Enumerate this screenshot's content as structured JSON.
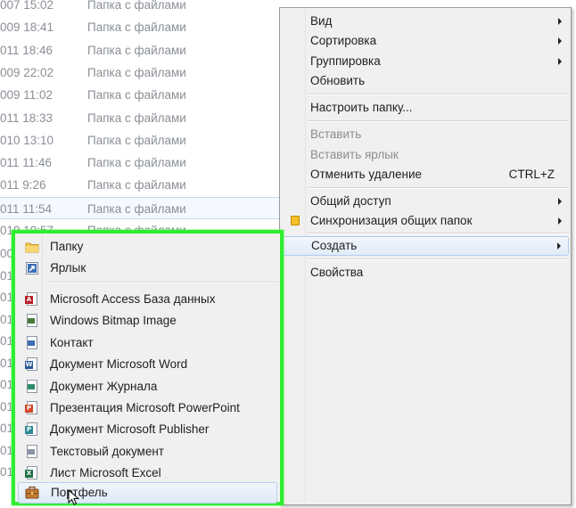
{
  "file_list": {
    "rows": [
      {
        "date": "007 15:02",
        "type": "Папка с файлами"
      },
      {
        "date": "009 18:41",
        "type": "Папка с файлами"
      },
      {
        "date": "011 18:46",
        "type": "Папка с файлами"
      },
      {
        "date": "009 22:02",
        "type": "Папка с файлами"
      },
      {
        "date": "009 11:02",
        "type": "Папка с файлами"
      },
      {
        "date": "011 18:33",
        "type": "Папка с файлами"
      },
      {
        "date": "010 13:10",
        "type": "Папка с файлами"
      },
      {
        "date": "011 11:46",
        "type": "Папка с файлами"
      },
      {
        "date": "011 9:26",
        "type": "Папка с файлами"
      },
      {
        "date": "011 11:54",
        "type": "Папка с файлами"
      },
      {
        "date": "010 10:57",
        "type": "Папка с файлами"
      }
    ],
    "left_stubs": [
      "009",
      "01",
      "01",
      "01",
      "01",
      "01",
      "01",
      "01",
      "01",
      "01",
      "01"
    ]
  },
  "context_menu": {
    "view": "Вид",
    "sort": "Сортировка",
    "group": "Группировка",
    "refresh": "Обновить",
    "customize": "Настроить папку...",
    "paste": "Вставить",
    "paste_shortcut": "Вставить ярлык",
    "undo_delete": "Отменить удаление",
    "undo_delete_key": "CTRL+Z",
    "share": "Общий доступ",
    "sync": "Синхронизация общих папок",
    "create": "Создать",
    "properties": "Свойства"
  },
  "new_submenu": {
    "folder": "Папку",
    "shortcut": "Ярлык",
    "items": [
      {
        "label": "Microsoft Access База данных",
        "icon": "access-db-icon",
        "badge": "A",
        "color": "#b3232b"
      },
      {
        "label": "Windows Bitmap Image",
        "icon": "bitmap-image-icon",
        "badge": "",
        "color": "#4a7a3a"
      },
      {
        "label": "Контакт",
        "icon": "contact-card-icon",
        "badge": "",
        "color": "#3a6fb0"
      },
      {
        "label": "Документ Microsoft Word",
        "icon": "word-doc-icon",
        "badge": "W",
        "color": "#2b579a"
      },
      {
        "label": "Документ Журнала",
        "icon": "journal-doc-icon",
        "badge": "",
        "color": "#2f8c6a"
      },
      {
        "label": "Презентация Microsoft PowerPoint",
        "icon": "powerpoint-icon",
        "badge": "P",
        "color": "#d24726"
      },
      {
        "label": "Документ Microsoft Publisher",
        "icon": "publisher-icon",
        "badge": "P",
        "color": "#2b8a96"
      },
      {
        "label": "Текстовый документ",
        "icon": "text-doc-icon",
        "badge": "",
        "color": "#8c96a6"
      },
      {
        "label": "Лист Microsoft Excel",
        "icon": "excel-icon",
        "badge": "X",
        "color": "#217346"
      }
    ],
    "briefcase": "Портфель"
  }
}
